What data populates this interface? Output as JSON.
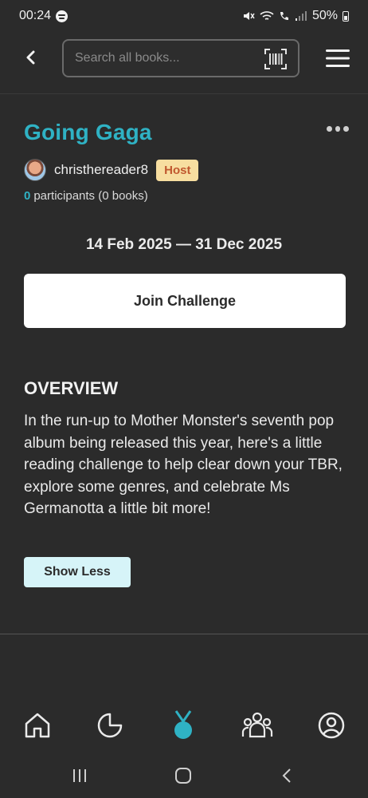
{
  "status_bar": {
    "time": "00:24",
    "battery": "50%"
  },
  "search": {
    "placeholder": "Search all books..."
  },
  "challenge": {
    "title": "Going Gaga",
    "host_name": "christhereader8",
    "host_badge": "Host",
    "participant_count": "0",
    "participants_text": "participants (0 books)",
    "date_range": "14 Feb 2025 — 31 Dec 2025",
    "join_label": "Join Challenge"
  },
  "overview": {
    "heading": "OVERVIEW",
    "text": "In the run-up to Mother Monster's seventh pop album being released this year, here's a little reading challenge to help clear down your TBR, explore some genres, and celebrate Ms Germanotta a little bit more!",
    "toggle_label": "Show Less"
  },
  "nav": {
    "items": [
      "home-icon",
      "stats-pie-icon",
      "challenges-medal-icon",
      "community-icon",
      "profile-icon"
    ],
    "active": "challenges-medal-icon"
  },
  "colors": {
    "background": "#2b2b2b",
    "accent": "#2fb2c4",
    "host_badge_bg": "#f7dea0",
    "host_badge_text": "#c0582f",
    "show_less_bg": "#d6f4f8"
  }
}
